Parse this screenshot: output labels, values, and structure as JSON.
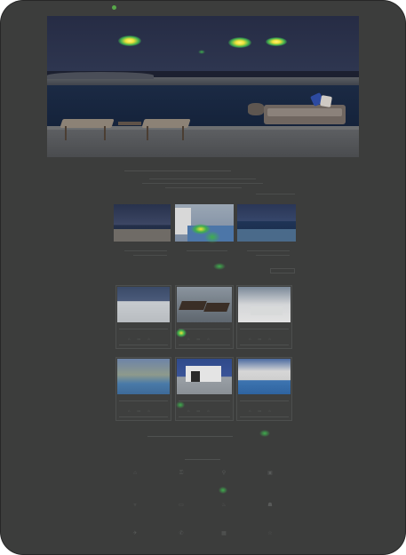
{
  "colors": {
    "overlay": "#3c3d3c",
    "heat_green": "#3fae4e",
    "heat_yellow": "#f0e23a",
    "heat_red": "#e84a2c",
    "pillow_blue": "#2d4aa0"
  },
  "header": {
    "logo_icon": "sun-logo-icon",
    "logo": "",
    "nav": ""
  },
  "intro": {
    "title": "",
    "body": ""
  },
  "featured": [
    {
      "scene": "coast-terrace",
      "caption": ""
    },
    {
      "scene": "pool-villa",
      "caption": ""
    },
    {
      "scene": "sea-view",
      "caption": ""
    }
  ],
  "properties": [
    {
      "scene": "terrace-sea"
    },
    {
      "scene": "loungers"
    },
    {
      "scene": "white-villa"
    },
    {
      "scene": "pool-garden"
    },
    {
      "scene": "modern-house"
    },
    {
      "scene": "pool-dusk"
    }
  ],
  "search_prompt": "",
  "services_title": "",
  "services": [
    {
      "icon": "house-icon"
    },
    {
      "icon": "key-icon"
    },
    {
      "icon": "pin-icon"
    },
    {
      "icon": "suitcase-icon"
    },
    {
      "icon": "cocktail-icon"
    },
    {
      "icon": "car-icon"
    },
    {
      "icon": "chef-icon"
    },
    {
      "icon": "concierge-icon"
    },
    {
      "icon": "plane-icon"
    },
    {
      "icon": "phone-icon"
    },
    {
      "icon": "calendar-icon"
    },
    {
      "icon": "star-icon"
    }
  ]
}
